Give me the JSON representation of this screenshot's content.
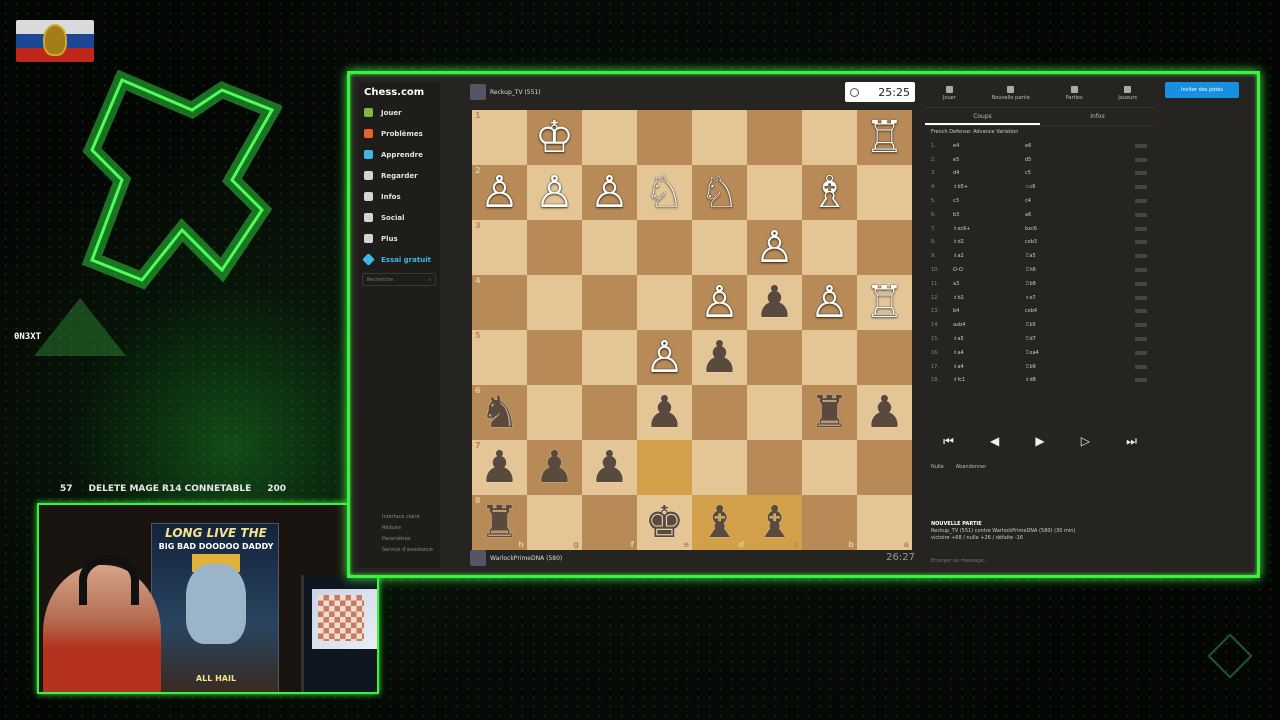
{
  "overlay": {
    "nickname": "0N3XT",
    "ticker_left": "57",
    "ticker_text": "DELETE MAGE R14 CONNETABLE",
    "ticker_right": "200",
    "poster_title": "LONG LIVE THE",
    "poster_subtitle": "BIG BAD DOODOO DADDY",
    "poster_footer": "ALL HAIL"
  },
  "sidebar": {
    "brand": "Chess.com",
    "items": [
      {
        "label": "Jouer",
        "icon": "pawn-icon",
        "color": "#81b64c"
      },
      {
        "label": "Problèmes",
        "icon": "puzzle-icon",
        "color": "#e5632c"
      },
      {
        "label": "Apprendre",
        "icon": "learn-icon",
        "color": "#3db7e8"
      },
      {
        "label": "Regarder",
        "icon": "watch-icon",
        "color": "#d4d4d4"
      },
      {
        "label": "Infos",
        "icon": "news-icon",
        "color": "#d4d4d4"
      },
      {
        "label": "Social",
        "icon": "social-icon",
        "color": "#d4d4d4"
      },
      {
        "label": "Plus",
        "icon": "more-icon",
        "color": "#d4d4d4"
      }
    ],
    "trial": "Essai gratuit",
    "search_placeholder": "Recherche",
    "bottom_links": [
      "Interface claire",
      "Réduire",
      "Paramètres",
      "Service d'assistance"
    ]
  },
  "game": {
    "top_player": "Reckup_TV (551)",
    "bottom_player": "WarlockPrimeDNA (580)",
    "top_clock": "25:25",
    "bottom_clock": "26:27",
    "board": [
      [
        "",
        "wK",
        "",
        "",
        "",
        "",
        "",
        "wR"
      ],
      [
        "wP",
        "wP",
        "wP",
        "wN",
        "wN",
        "",
        "wB",
        ""
      ],
      [
        "",
        "",
        "",
        "",
        "",
        "wP",
        "",
        ""
      ],
      [
        "",
        "",
        "",
        "",
        "wP",
        "bP",
        "wP",
        "wR"
      ],
      [
        "",
        "",
        "",
        "wP",
        "bP",
        "",
        "",
        ""
      ],
      [
        "bN",
        "",
        "",
        "bP",
        "",
        "",
        "bR",
        "bP"
      ],
      [
        "bP",
        "bP",
        "bP",
        "",
        "",
        "",
        "",
        ""
      ],
      [
        "bR",
        "",
        "",
        "bK",
        "bB",
        "bB",
        "",
        ""
      ]
    ],
    "rank_labels": [
      "1",
      "2",
      "3",
      "4",
      "5",
      "6",
      "7",
      "8"
    ],
    "file_labels": [
      "h",
      "g",
      "f",
      "e",
      "d",
      "c",
      "b",
      "a"
    ]
  },
  "panel": {
    "tabs": [
      "Jouer",
      "Nouvelle partie",
      "Parties",
      "Joueurs"
    ],
    "cta": "Inviter des potes",
    "subtabs": [
      "Coups",
      "Infos"
    ],
    "opening": "French Defense: Advance Variation",
    "moves": [
      {
        "n": "1.",
        "w": "e4",
        "b": "e6"
      },
      {
        "n": "2.",
        "w": "e5",
        "b": "d5"
      },
      {
        "n": "3.",
        "w": "d4",
        "b": "c5"
      },
      {
        "n": "4.",
        "w": "♗b5+",
        "b": "♘c6"
      },
      {
        "n": "5.",
        "w": "c3",
        "b": "c4"
      },
      {
        "n": "6.",
        "w": "b3",
        "b": "a6"
      },
      {
        "n": "7.",
        "w": "♗xc6+",
        "b": "bxc6"
      },
      {
        "n": "8.",
        "w": "♗d2",
        "b": "cxb3"
      },
      {
        "n": "9.",
        "w": "♗a2",
        "b": "♖a5"
      },
      {
        "n": "10.",
        "w": "O-O",
        "b": "♖h6"
      },
      {
        "n": "11.",
        "w": "a3",
        "b": "♖b8"
      },
      {
        "n": "12.",
        "w": "♗b2",
        "b": "♗e7"
      },
      {
        "n": "13.",
        "w": "b4",
        "b": "cxb4"
      },
      {
        "n": "14.",
        "w": "axb4",
        "b": "♖b5"
      },
      {
        "n": "15.",
        "w": "♗a5",
        "b": "♖d7"
      },
      {
        "n": "16.",
        "w": "♗a4",
        "b": "♖xa4"
      },
      {
        "n": "17.",
        "w": "♗a4",
        "b": "♖b6"
      },
      {
        "n": "18.",
        "w": "♗fc1",
        "b": "♗d8"
      }
    ],
    "actions": [
      "Nulle",
      "Abandonner"
    ],
    "newgame_title": "NOUVELLE PARTIE",
    "newgame_line1": "Reckup_TV (551) contre WarlockPrimeDNA (580) (30 min)",
    "newgame_line2": "victoire +68 / nulle +26 / défaite -16",
    "message_placeholder": "Envoyer un message..."
  }
}
